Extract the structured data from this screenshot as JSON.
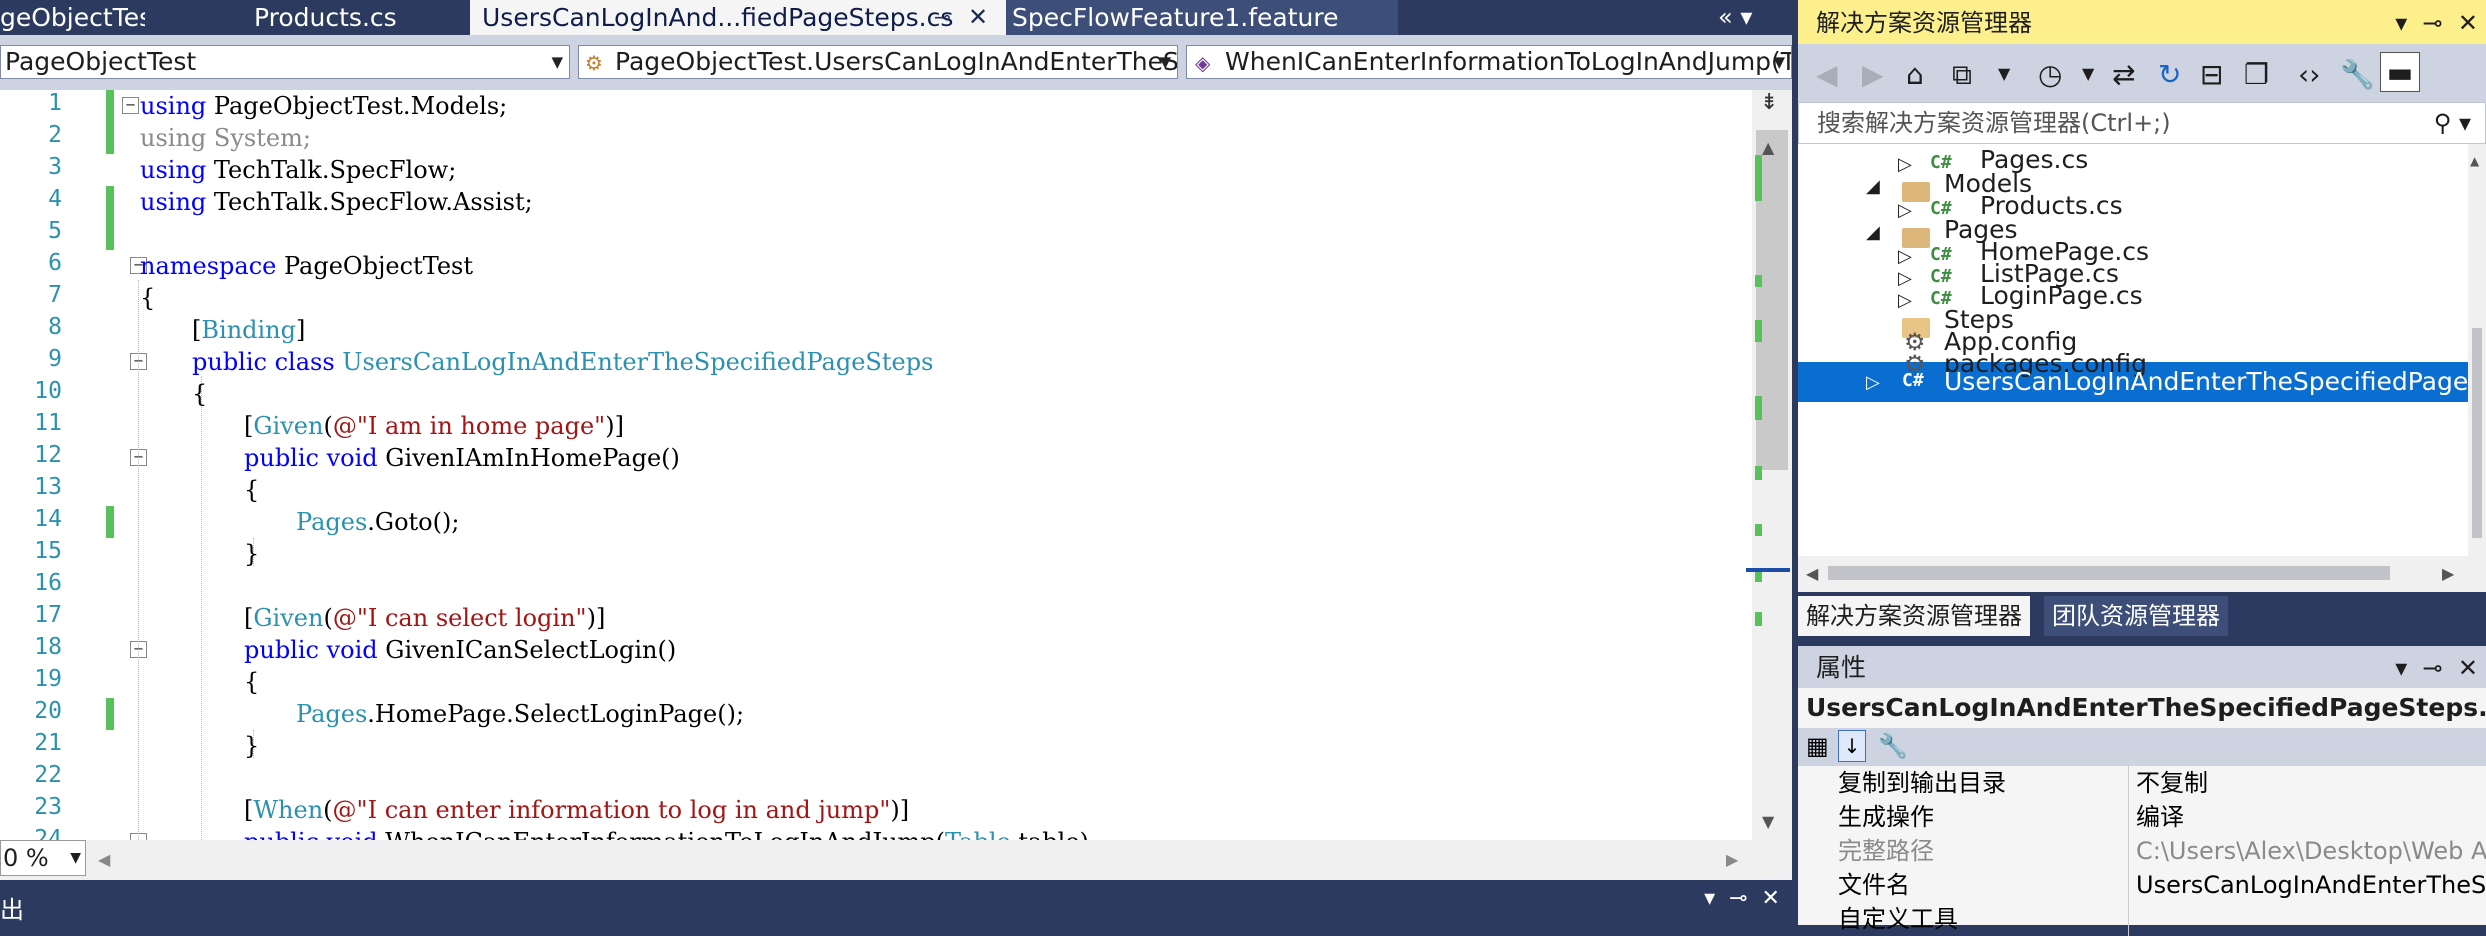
{
  "tabs": [
    {
      "label": "geObjectTest"
    },
    {
      "label": "Products.cs"
    },
    {
      "label": "UsersCanLogInAnd...fiedPageSteps.cs"
    },
    {
      "label": "SpecFlowFeature1.feature"
    }
  ],
  "tab_pin_glyph": "⊸",
  "tab_close_glyph": "✕",
  "tab_overflow_glyphs": "«  ▾",
  "navbar": {
    "project": "PageObjectTest",
    "class": "PageObjectTest.UsersCanLogInAndEnterTheSp",
    "member": "WhenICanEnterInformationToLogInAndJump(T"
  },
  "code": {
    "line_numbers": [
      "1",
      "2",
      "3",
      "4",
      "5",
      "6",
      "7",
      "8",
      "9",
      "10",
      "11",
      "12",
      "13",
      "14",
      "15",
      "16",
      "17",
      "18",
      "19",
      "20",
      "21",
      "22",
      "23",
      "24"
    ],
    "lines": {
      "l1_kw": "using",
      "l1_rest": " PageObjectTest.Models;",
      "l2": "using System;",
      "l3_kw": "using",
      "l3_rest": " TechTalk.SpecFlow;",
      "l4_kw": "using",
      "l4_rest": " TechTalk.SpecFlow.Assist;",
      "l6_kw": "namespace",
      "l6_rest": " PageObjectTest",
      "l7": "{",
      "l8_a": "[",
      "l8_ty": "Binding",
      "l8_b": "]",
      "l9_kw": "public class",
      "l9_ty": " UsersCanLogInAndEnterTheSpecifiedPageSteps",
      "l10": "{",
      "l11_a": "[",
      "l11_ty": "Given",
      "l11_b": "(",
      "l11_st": "@\"I am in home page\"",
      "l11_c": ")]",
      "l12_kw": "public void",
      "l12_rest": " GivenIAmInHomePage()",
      "l13": "{",
      "l14_ty": "Pages",
      "l14_rest": ".Goto();",
      "l15": "}",
      "l17_a": "[",
      "l17_ty": "Given",
      "l17_b": "(",
      "l17_st": "@\"I can select login\"",
      "l17_c": ")]",
      "l18_kw": "public void",
      "l18_rest": " GivenICanSelectLogin()",
      "l19": "{",
      "l20_ty": "Pages",
      "l20_rest": ".HomePage.SelectLoginPage();",
      "l21": "}",
      "l23_a": "[",
      "l23_ty": "When",
      "l23_b": "(",
      "l23_st": "@\"I can enter information to log in and jump\"",
      "l23_c": ")]",
      "l24_kw": "public void",
      "l24_rest": " WhenICanEnterInformationToLogInAndJump(",
      "l24_ty": "Table",
      "l24_end": " table)"
    }
  },
  "zoom": "0 %",
  "output_panel": {
    "title": "出"
  },
  "solution_explorer": {
    "title": "解决方案资源管理器",
    "search_placeholder": "搜索解决方案资源管理器(Ctrl+;)",
    "items": [
      {
        "label": "Pages.cs"
      },
      {
        "label": "Models"
      },
      {
        "label": "Products.cs"
      },
      {
        "label": "Pages"
      },
      {
        "label": "HomePage.cs"
      },
      {
        "label": "ListPage.cs"
      },
      {
        "label": "LoginPage.cs"
      },
      {
        "label": "Steps"
      },
      {
        "label": "App.config"
      },
      {
        "label": "packages.config"
      },
      {
        "label": "UsersCanLogInAndEnterTheSpecifiedPageSteps.cs"
      }
    ],
    "bottom_tabs": [
      "解决方案资源管理器",
      "团队资源管理器"
    ]
  },
  "properties": {
    "title": "属性",
    "object": "UsersCanLogInAndEnterTheSpecifiedPageSteps.cs 文件",
    "rows": [
      {
        "name": "复制到输出目录",
        "value": "不复制"
      },
      {
        "name": "生成操作",
        "value": "编译"
      },
      {
        "name": "完整路径",
        "value": "C:\\Users\\Alex\\Desktop\\Web Au"
      },
      {
        "name": "文件名",
        "value": "UsersCanLogInAndEnterTheSp"
      },
      {
        "name": "自定义工具",
        "value": ""
      }
    ]
  },
  "colors": {
    "accent": "#0a6ed1",
    "chrome": "#2b3a5e",
    "tool_title": "#fdf08c"
  }
}
